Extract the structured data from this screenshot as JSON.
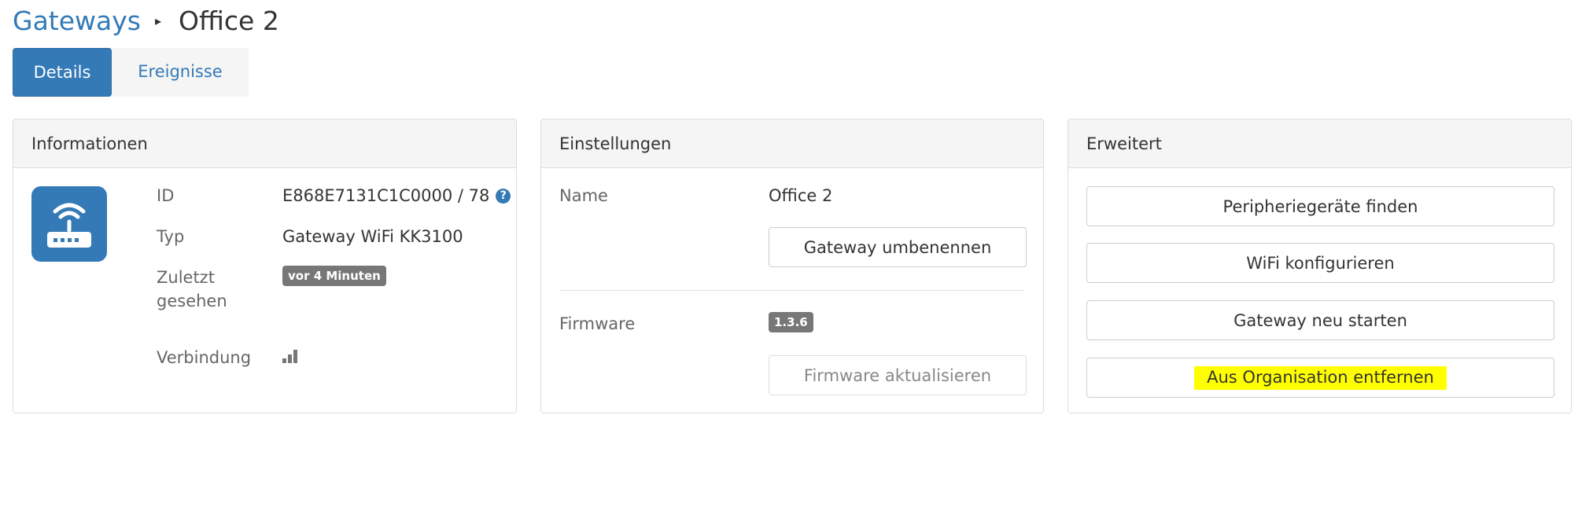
{
  "breadcrumb": {
    "parent": "Gateways",
    "separator": "▸",
    "current": "Office 2"
  },
  "tabs": [
    {
      "label": "Details",
      "active": true
    },
    {
      "label": "Ereignisse",
      "active": false
    }
  ],
  "info_panel": {
    "title": "Informationen",
    "icon": "router-icon",
    "rows": {
      "id": {
        "label": "ID",
        "value": "E868E7131C1C0000 / 78",
        "help_icon": "?"
      },
      "typ": {
        "label": "Typ",
        "value": "Gateway WiFi KK3100"
      },
      "zuletzt": {
        "label_line1": "Zuletzt",
        "label_line2": "gesehen",
        "badge": "vor 4 Minuten"
      },
      "verbindung": {
        "label": "Verbindung",
        "signal_icon": "signal-bars-icon"
      }
    }
  },
  "settings_panel": {
    "title": "Einstellungen",
    "name_label": "Name",
    "name_value": "Office 2",
    "rename_button": "Gateway umbenennen",
    "firmware_label": "Firmware",
    "firmware_version": "1.3.6",
    "update_button": "Firmware aktualisieren"
  },
  "advanced_panel": {
    "title": "Erweitert",
    "buttons": {
      "find": "Peripheriegeräte finden",
      "wifi": "WiFi konfigurieren",
      "restart": "Gateway neu starten",
      "remove": "Aus Organisation entfernen"
    }
  },
  "colors": {
    "primary": "#337ab7",
    "badge": "#777777",
    "highlight": "#ffff00",
    "panel_heading": "#f5f5f5"
  }
}
